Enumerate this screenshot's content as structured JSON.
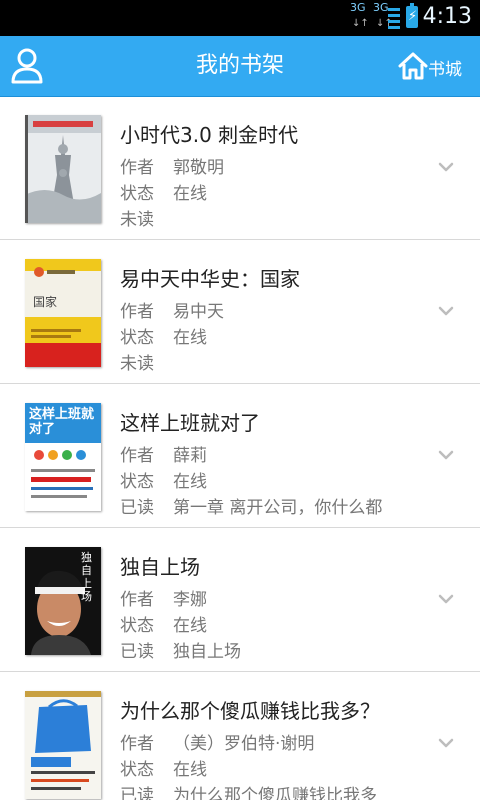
{
  "status_bar": {
    "network1": "3G",
    "network2": "3G",
    "time": "4:13"
  },
  "header": {
    "title": "我的书架",
    "store_label": "书城"
  },
  "books": [
    {
      "title": "小时代3.0 刺金时代",
      "author_label": "作者",
      "author": "郭敬明",
      "status_label": "状态",
      "status": "在线",
      "read_label": "未读",
      "read_detail": ""
    },
    {
      "title": "易中天中华史：国家",
      "author_label": "作者",
      "author": "易中天",
      "status_label": "状态",
      "status": "在线",
      "read_label": "未读",
      "read_detail": ""
    },
    {
      "title": "这样上班就对了",
      "author_label": "作者",
      "author": "薛莉",
      "status_label": "状态",
      "status": "在线",
      "read_label": "已读",
      "read_detail": "第一章 离开公司，你什么都"
    },
    {
      "title": "独自上场",
      "author_label": "作者",
      "author": "李娜",
      "status_label": "状态",
      "status": "在线",
      "read_label": "已读",
      "read_detail": "独自上场"
    },
    {
      "title": "为什么那个傻瓜赚钱比我多？",
      "author_label": "作者",
      "author": "（美）罗伯特·谢明",
      "status_label": "状态",
      "status": "在线",
      "read_label": "已读",
      "read_detail": "为什么那个傻瓜赚钱比我多"
    }
  ],
  "covers": [
    {
      "text": "",
      "bg": "#dfe3e6"
    },
    {
      "text": "国家",
      "bg": "#f2f0e6"
    },
    {
      "text": "这样上班就对了",
      "bg": "#ffffff"
    },
    {
      "text": "独自上场",
      "bg": "#101010"
    },
    {
      "text": "",
      "bg": "#f4f4ee"
    }
  ],
  "colors": {
    "accent": "#33aaf2",
    "title_text": "#222222",
    "meta_text": "#777777"
  }
}
